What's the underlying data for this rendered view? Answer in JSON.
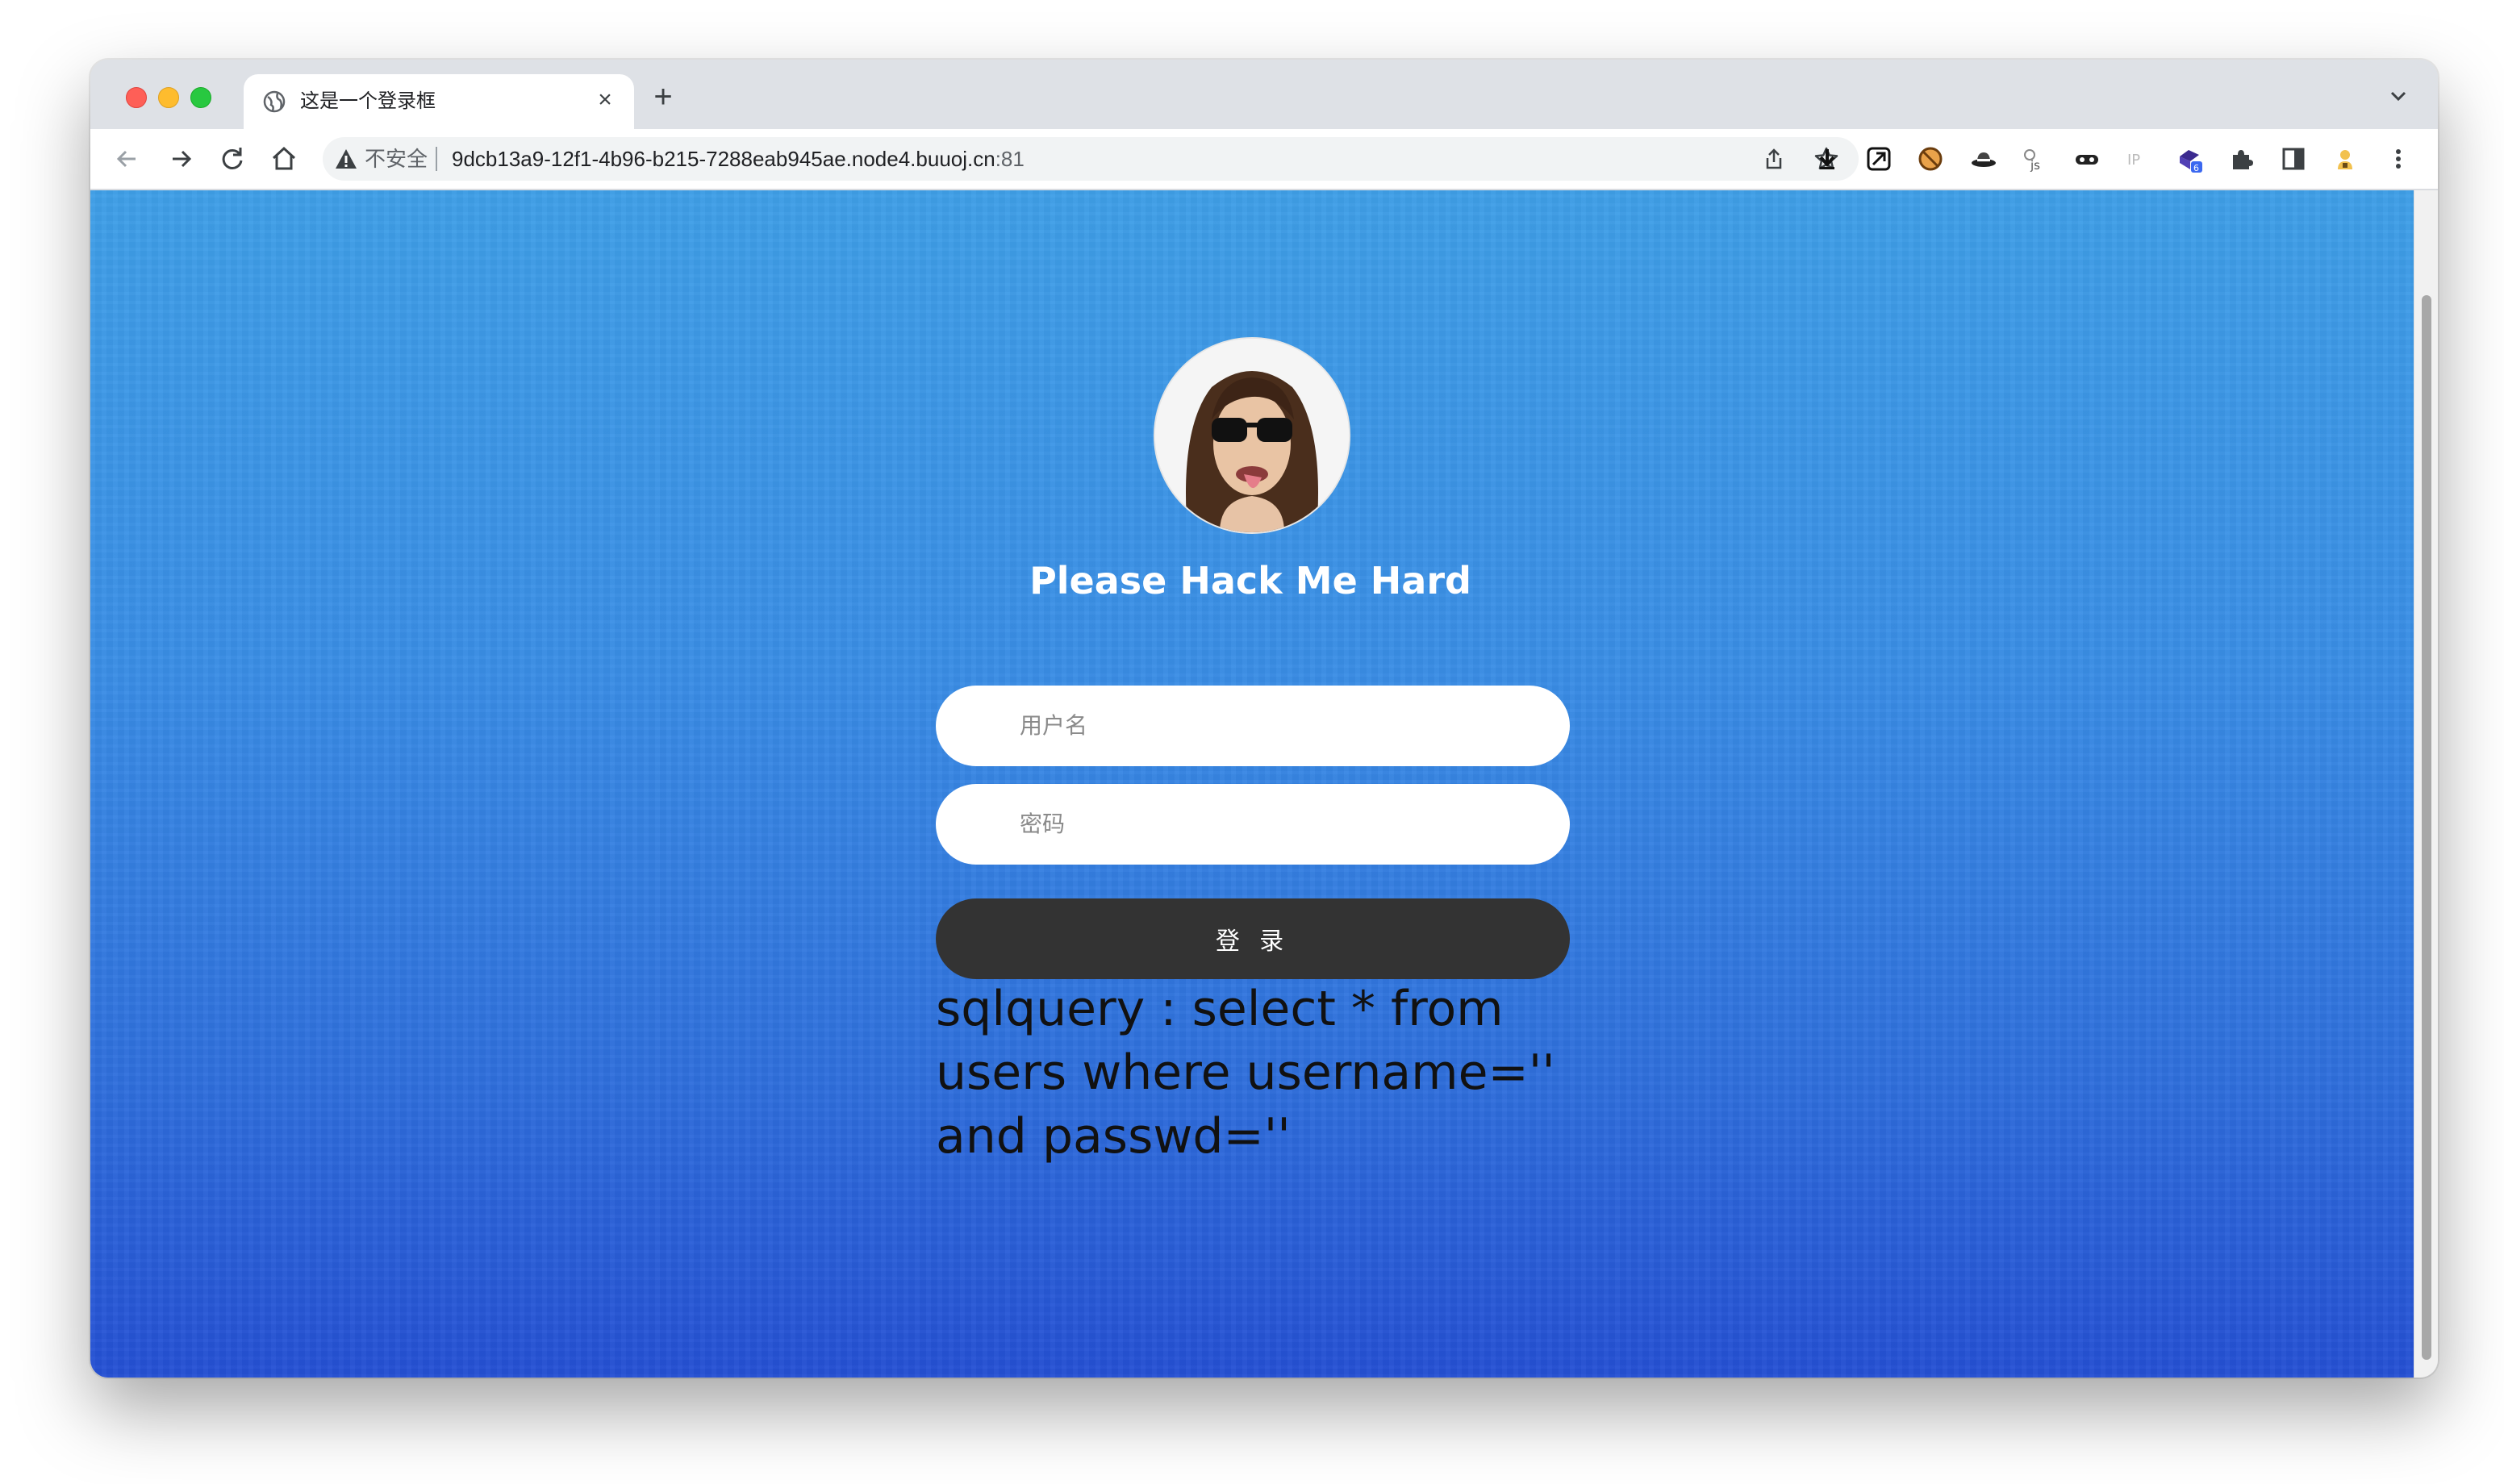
{
  "browser": {
    "tab": {
      "title": "这是一个登录框",
      "close": "×"
    },
    "new_tab": "+",
    "address": {
      "security_label": "不安全",
      "host": "9dcb13a9-12f1-4b96-b215-7288eab945ae.node4.buuoj.cn",
      "port": ":81"
    },
    "extensions": [
      "download-icon",
      "send-icon",
      "block-icon",
      "hat-icon",
      "js-icon",
      "mask-icon",
      "ip-icon",
      "cube-icon",
      "puzzle-icon",
      "sidepanel-icon",
      "person-icon",
      "menu-icon"
    ],
    "extension_badge": "6",
    "ip_label": "IP",
    "js_label": "js"
  },
  "page": {
    "title": "Please Hack Me Hard",
    "username_placeholder": "用户名",
    "password_placeholder": "密码",
    "login_button": "登 录",
    "sql_query": "sqlquery : select * from users where username='' and passwd=''"
  },
  "colors": {
    "background_top": "#3f9fe8",
    "background_bottom": "#2550d4",
    "button": "#333333"
  }
}
